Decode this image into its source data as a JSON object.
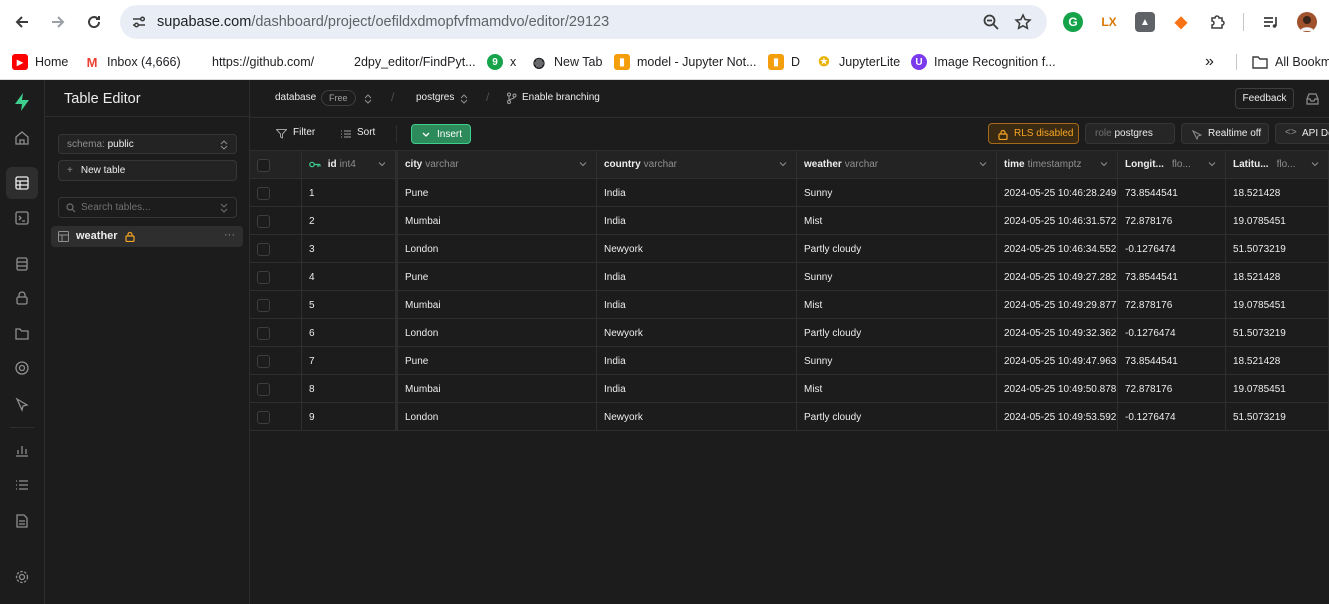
{
  "browser": {
    "url_host": "supabase.com",
    "url_path": "/dashboard/project/oefildxdmopfvfmamdvo/editor/29123",
    "bookmarks": [
      "Home",
      "Inbox (4,666)",
      "https://github.com/",
      "2dpy_editor/FindPyt...",
      "x",
      "New Tab",
      "model - Jupyter Not...",
      "D",
      "JupyterLite",
      "Image Recognition f...",
      "All Bookm"
    ],
    "more": "»"
  },
  "sidebar": {
    "title": "Table Editor",
    "schema_label": "schema:",
    "schema_value": "public",
    "new_table": "New table",
    "search_placeholder": "Search tables...",
    "tables": [
      {
        "name": "weather"
      }
    ],
    "more": "···"
  },
  "topbar": {
    "database": "database",
    "plan": "Free",
    "branch_db": "postgres",
    "branching": "Enable branching",
    "feedback": "Feedback"
  },
  "toolbar": {
    "filter": "Filter",
    "sort": "Sort",
    "insert": "Insert",
    "rls": "RLS disabled",
    "role_label": "role",
    "role_value": "postgres",
    "realtime": "Realtime off",
    "api_docs": "API Do"
  },
  "columns": [
    {
      "name": "id",
      "type": "int4"
    },
    {
      "name": "city",
      "type": "varchar"
    },
    {
      "name": "country",
      "type": "varchar"
    },
    {
      "name": "weather",
      "type": "varchar"
    },
    {
      "name": "time",
      "type": "timestamptz"
    },
    {
      "name": "Longit...",
      "type": "flo..."
    },
    {
      "name": "Latitu...",
      "type": "flo..."
    }
  ],
  "rows": [
    [
      "1",
      "Pune",
      "India",
      "Sunny",
      "2024-05-25 10:46:28.249",
      "73.8544541",
      "18.521428"
    ],
    [
      "2",
      "Mumbai",
      "India",
      "Mist",
      "2024-05-25 10:46:31.572",
      "72.878176",
      "19.0785451"
    ],
    [
      "3",
      "London",
      "Newyork",
      "Partly cloudy",
      "2024-05-25 10:46:34.552",
      "-0.1276474",
      "51.5073219"
    ],
    [
      "4",
      "Pune",
      "India",
      "Sunny",
      "2024-05-25 10:49:27.282",
      "73.8544541",
      "18.521428"
    ],
    [
      "5",
      "Mumbai",
      "India",
      "Mist",
      "2024-05-25 10:49:29.877",
      "72.878176",
      "19.0785451"
    ],
    [
      "6",
      "London",
      "Newyork",
      "Partly cloudy",
      "2024-05-25 10:49:32.362",
      "-0.1276474",
      "51.5073219"
    ],
    [
      "7",
      "Pune",
      "India",
      "Sunny",
      "2024-05-25 10:49:47.963",
      "73.8544541",
      "18.521428"
    ],
    [
      "8",
      "Mumbai",
      "India",
      "Mist",
      "2024-05-25 10:49:50.878",
      "72.878176",
      "19.0785451"
    ],
    [
      "9",
      "London",
      "Newyork",
      "Partly cloudy",
      "2024-05-25 10:49:53.592",
      "-0.1276474",
      "51.5073219"
    ]
  ],
  "colors": {
    "accent": "#3ecf8e",
    "warning": "#f5a623",
    "bg": "#1c1c1c"
  }
}
